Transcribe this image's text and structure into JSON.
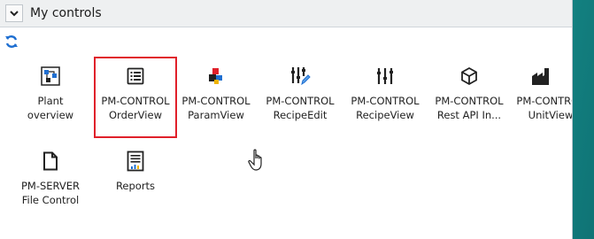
{
  "header": {
    "title": "My controls"
  },
  "tiles": [
    {
      "line1": "Plant",
      "line2": "overview",
      "icon": "plant-overview-icon"
    },
    {
      "line1": "PM-CONTROL",
      "line2": "OrderView",
      "icon": "order-list-icon"
    },
    {
      "line1": "PM-CONTROL",
      "line2": "ParamView",
      "icon": "param-blocks-icon"
    },
    {
      "line1": "PM-CONTROL",
      "line2": "RecipeEdit",
      "icon": "recipe-edit-icon"
    },
    {
      "line1": "PM-CONTROL",
      "line2": "RecipeView",
      "icon": "recipe-sliders-icon"
    },
    {
      "line1": "PM-CONTROL",
      "line2": "Rest API In...",
      "icon": "cube-icon"
    },
    {
      "line1": "PM-CONTROL",
      "line2": "UnitView",
      "icon": "factory-icon"
    },
    {
      "line1": "PM-SERVER",
      "line2": "File Control",
      "icon": "file-icon"
    },
    {
      "line1": "Reports",
      "line2": "",
      "icon": "report-icon"
    }
  ],
  "colors": {
    "selection": "#e0202a",
    "accent_blue": "#1f6fd1"
  }
}
